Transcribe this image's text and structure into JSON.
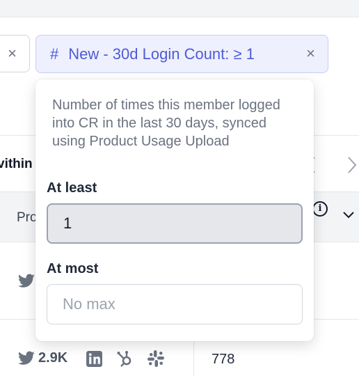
{
  "filters": {
    "left_chip_close": "×",
    "active_chip": {
      "icon": "#",
      "label": "New - 30d Login Count: ≥ 1",
      "close": "×"
    }
  },
  "table": {
    "group_label": "vithin",
    "header_label": "Pro",
    "row_value": "778",
    "twitter_count": "2.9K",
    "info_glyph": "i"
  },
  "popover": {
    "description": "Number of times this member logged into CR in the last 30 days, synced using Product Usage Upload",
    "at_least_label": "At least",
    "at_least_value": "1",
    "at_most_label": "At most",
    "at_most_placeholder": "No max"
  },
  "colors": {
    "accent": "#4f5bd5",
    "chip_bg": "#eef0fd"
  }
}
